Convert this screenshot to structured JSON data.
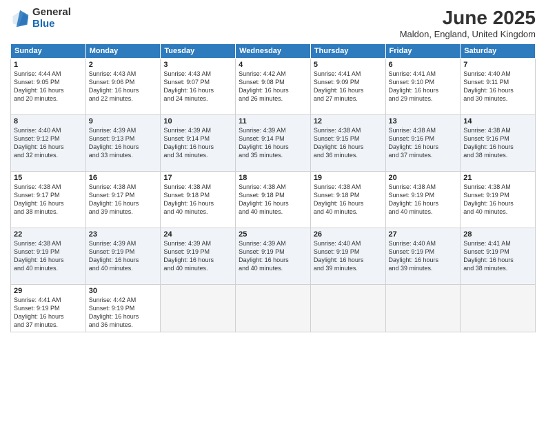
{
  "header": {
    "logo_general": "General",
    "logo_blue": "Blue",
    "month_title": "June 2025",
    "location": "Maldon, England, United Kingdom"
  },
  "days_of_week": [
    "Sunday",
    "Monday",
    "Tuesday",
    "Wednesday",
    "Thursday",
    "Friday",
    "Saturday"
  ],
  "weeks": [
    [
      {
        "day": "1",
        "sunrise": "4:44 AM",
        "sunset": "9:05 PM",
        "daylight": "16 hours and 20 minutes."
      },
      {
        "day": "2",
        "sunrise": "4:43 AM",
        "sunset": "9:06 PM",
        "daylight": "16 hours and 22 minutes."
      },
      {
        "day": "3",
        "sunrise": "4:43 AM",
        "sunset": "9:07 PM",
        "daylight": "16 hours and 24 minutes."
      },
      {
        "day": "4",
        "sunrise": "4:42 AM",
        "sunset": "9:08 PM",
        "daylight": "16 hours and 26 minutes."
      },
      {
        "day": "5",
        "sunrise": "4:41 AM",
        "sunset": "9:09 PM",
        "daylight": "16 hours and 27 minutes."
      },
      {
        "day": "6",
        "sunrise": "4:41 AM",
        "sunset": "9:10 PM",
        "daylight": "16 hours and 29 minutes."
      },
      {
        "day": "7",
        "sunrise": "4:40 AM",
        "sunset": "9:11 PM",
        "daylight": "16 hours and 30 minutes."
      }
    ],
    [
      {
        "day": "8",
        "sunrise": "4:40 AM",
        "sunset": "9:12 PM",
        "daylight": "16 hours and 32 minutes."
      },
      {
        "day": "9",
        "sunrise": "4:39 AM",
        "sunset": "9:13 PM",
        "daylight": "16 hours and 33 minutes."
      },
      {
        "day": "10",
        "sunrise": "4:39 AM",
        "sunset": "9:14 PM",
        "daylight": "16 hours and 34 minutes."
      },
      {
        "day": "11",
        "sunrise": "4:39 AM",
        "sunset": "9:14 PM",
        "daylight": "16 hours and 35 minutes."
      },
      {
        "day": "12",
        "sunrise": "4:38 AM",
        "sunset": "9:15 PM",
        "daylight": "16 hours and 36 minutes."
      },
      {
        "day": "13",
        "sunrise": "4:38 AM",
        "sunset": "9:16 PM",
        "daylight": "16 hours and 37 minutes."
      },
      {
        "day": "14",
        "sunrise": "4:38 AM",
        "sunset": "9:16 PM",
        "daylight": "16 hours and 38 minutes."
      }
    ],
    [
      {
        "day": "15",
        "sunrise": "4:38 AM",
        "sunset": "9:17 PM",
        "daylight": "16 hours and 38 minutes."
      },
      {
        "day": "16",
        "sunrise": "4:38 AM",
        "sunset": "9:17 PM",
        "daylight": "16 hours and 39 minutes."
      },
      {
        "day": "17",
        "sunrise": "4:38 AM",
        "sunset": "9:18 PM",
        "daylight": "16 hours and 40 minutes."
      },
      {
        "day": "18",
        "sunrise": "4:38 AM",
        "sunset": "9:18 PM",
        "daylight": "16 hours and 40 minutes."
      },
      {
        "day": "19",
        "sunrise": "4:38 AM",
        "sunset": "9:18 PM",
        "daylight": "16 hours and 40 minutes."
      },
      {
        "day": "20",
        "sunrise": "4:38 AM",
        "sunset": "9:19 PM",
        "daylight": "16 hours and 40 minutes."
      },
      {
        "day": "21",
        "sunrise": "4:38 AM",
        "sunset": "9:19 PM",
        "daylight": "16 hours and 40 minutes."
      }
    ],
    [
      {
        "day": "22",
        "sunrise": "4:38 AM",
        "sunset": "9:19 PM",
        "daylight": "16 hours and 40 minutes."
      },
      {
        "day": "23",
        "sunrise": "4:39 AM",
        "sunset": "9:19 PM",
        "daylight": "16 hours and 40 minutes."
      },
      {
        "day": "24",
        "sunrise": "4:39 AM",
        "sunset": "9:19 PM",
        "daylight": "16 hours and 40 minutes."
      },
      {
        "day": "25",
        "sunrise": "4:39 AM",
        "sunset": "9:19 PM",
        "daylight": "16 hours and 40 minutes."
      },
      {
        "day": "26",
        "sunrise": "4:40 AM",
        "sunset": "9:19 PM",
        "daylight": "16 hours and 39 minutes."
      },
      {
        "day": "27",
        "sunrise": "4:40 AM",
        "sunset": "9:19 PM",
        "daylight": "16 hours and 39 minutes."
      },
      {
        "day": "28",
        "sunrise": "4:41 AM",
        "sunset": "9:19 PM",
        "daylight": "16 hours and 38 minutes."
      }
    ],
    [
      {
        "day": "29",
        "sunrise": "4:41 AM",
        "sunset": "9:19 PM",
        "daylight": "16 hours and 37 minutes."
      },
      {
        "day": "30",
        "sunrise": "4:42 AM",
        "sunset": "9:19 PM",
        "daylight": "16 hours and 36 minutes."
      },
      null,
      null,
      null,
      null,
      null
    ]
  ],
  "labels": {
    "sunrise": "Sunrise:",
    "sunset": "Sunset:",
    "daylight": "Daylight:"
  }
}
